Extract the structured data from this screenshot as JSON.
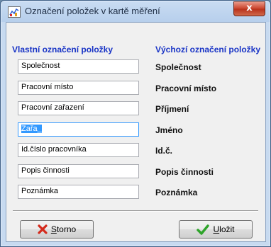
{
  "window": {
    "title": "Označení položek v kartě měření",
    "close_label": "x"
  },
  "headers": {
    "left": "Vlastní označení položky",
    "right": "Výchozí označení položky"
  },
  "rows": [
    {
      "value": "Společnost",
      "default": "Společnost"
    },
    {
      "value": "Pracovní místo",
      "default": "Pracovní místo"
    },
    {
      "value": "Pracovní zařazení",
      "default": "Příjmení"
    },
    {
      "value": "Zařa_",
      "default": "Jméno",
      "active": true
    },
    {
      "value": "Id.číslo pracovníka",
      "default": "Id.č."
    },
    {
      "value": "Popis činnosti",
      "default": "Popis činnosti"
    },
    {
      "value": "Poznámka",
      "default": "Poznámka"
    }
  ],
  "buttons": {
    "cancel_mnemonic": "S",
    "cancel_rest": "torno",
    "save_mnemonic": "U",
    "save_rest": "ložit"
  },
  "colors": {
    "header_blue": "#1a35c6",
    "cancel_icon": "#d42a1c",
    "save_icon": "#2ea42a"
  }
}
